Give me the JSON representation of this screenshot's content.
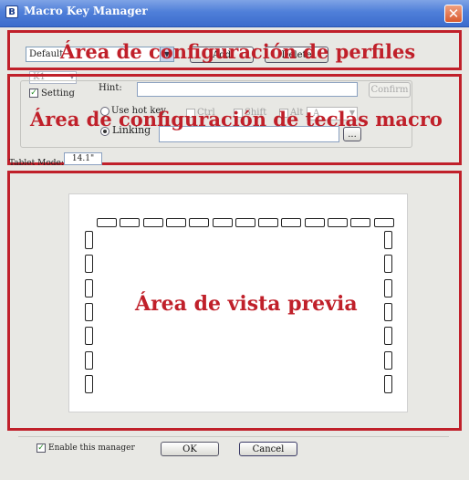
{
  "window": {
    "title": "Macro Key Manager",
    "icon_glyph": "B",
    "close_glyph": "✕"
  },
  "annotations": {
    "profile_area": "Área de configuración de perfiles",
    "macro_area": "Área de configuración de teclas macro",
    "preview_area": "Área de vista previa"
  },
  "profile": {
    "selected": "Default",
    "add_button": "Add",
    "delete_button": "Delete",
    "key_selected": "K1"
  },
  "macro": {
    "setting_checkbox": "Setting",
    "setting_checked": true,
    "hint_label": "Hint:",
    "hint_value": "",
    "confirm_button": "Confirm",
    "use_hot_key": "Use hot key",
    "ctrl": "Ctrl",
    "shift": "Shift",
    "alt": "Alt",
    "hot_key_value": "A",
    "linking": "Linking",
    "linking_value": "",
    "browse_button": "..."
  },
  "tablet": {
    "label": "Tablet Mode:",
    "value": "14.1\""
  },
  "footer": {
    "enable_label": "Enable this manager",
    "enable_checked": true,
    "ok_button": "OK",
    "cancel_button": "Cancel"
  },
  "preview": {
    "top_keys": 13,
    "left_keys": 7,
    "right_keys": 7
  },
  "colors": {
    "annotation_red": "#c0202a",
    "titlebar_blue": "#4f7fd9",
    "window_bg": "#e8e8e4"
  }
}
